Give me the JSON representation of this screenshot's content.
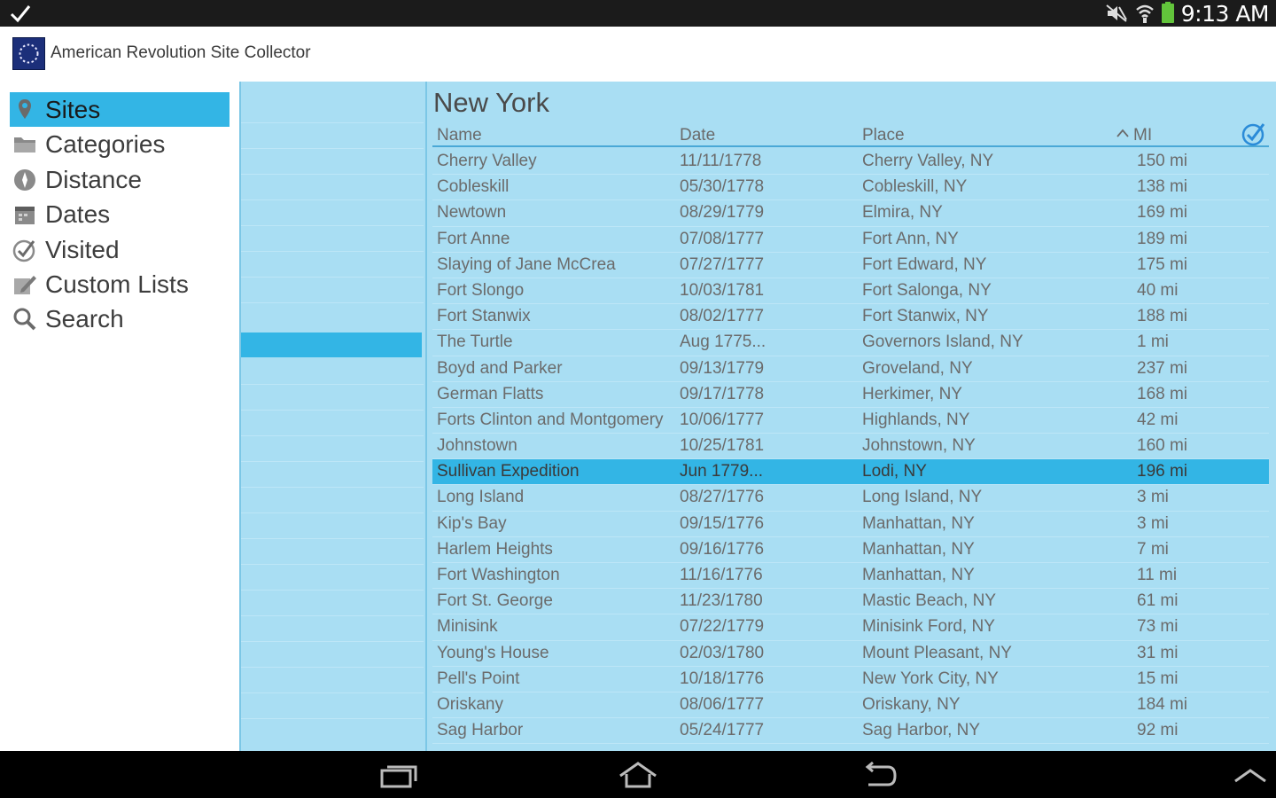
{
  "status": {
    "time": "9:13 AM"
  },
  "app": {
    "title": "American Revolution Site Collector"
  },
  "nav": {
    "items": [
      {
        "label": "Sites",
        "icon": "pin-icon",
        "active": true
      },
      {
        "label": "Categories",
        "icon": "folder-icon",
        "active": false
      },
      {
        "label": "Distance",
        "icon": "compass-icon",
        "active": false
      },
      {
        "label": "Dates",
        "icon": "calendar-icon",
        "active": false
      },
      {
        "label": "Visited",
        "icon": "check-circle-icon",
        "active": false
      },
      {
        "label": "Custom Lists",
        "icon": "edit-list-icon",
        "active": false
      },
      {
        "label": "Search",
        "icon": "search-icon",
        "active": false
      }
    ]
  },
  "list": {
    "region": "New York",
    "headers": {
      "name": "Name",
      "date": "Date",
      "place": "Place",
      "mi": "MI"
    },
    "rows": [
      {
        "name": "Cherry Valley",
        "date": "11/11/1778",
        "place": "Cherry Valley, NY",
        "mi": "150 mi"
      },
      {
        "name": "Cobleskill",
        "date": "05/30/1778",
        "place": "Cobleskill, NY",
        "mi": "138 mi"
      },
      {
        "name": "Newtown",
        "date": "08/29/1779",
        "place": "Elmira, NY",
        "mi": "169 mi"
      },
      {
        "name": "Fort Anne",
        "date": "07/08/1777",
        "place": "Fort Ann, NY",
        "mi": "189 mi"
      },
      {
        "name": "Slaying of Jane McCrea",
        "date": "07/27/1777",
        "place": "Fort Edward, NY",
        "mi": "175 mi"
      },
      {
        "name": "Fort Slongo",
        "date": "10/03/1781",
        "place": "Fort Salonga, NY",
        "mi": "40 mi"
      },
      {
        "name": "Fort Stanwix",
        "date": "08/02/1777",
        "place": "Fort Stanwix, NY",
        "mi": "188 mi"
      },
      {
        "name": "The Turtle",
        "date": "Aug 1775...",
        "place": "Governors Island, NY",
        "mi": "1 mi"
      },
      {
        "name": "Boyd and Parker",
        "date": "09/13/1779",
        "place": "Groveland, NY",
        "mi": "237 mi"
      },
      {
        "name": "German Flatts",
        "date": "09/17/1778",
        "place": "Herkimer, NY",
        "mi": "168 mi"
      },
      {
        "name": "Forts Clinton and Montgomery",
        "date": "10/06/1777",
        "place": "Highlands, NY",
        "mi": "42 mi"
      },
      {
        "name": "Johnstown",
        "date": "10/25/1781",
        "place": "Johnstown, NY",
        "mi": "160 mi"
      },
      {
        "name": "Sullivan Expedition",
        "date": "Jun 1779...",
        "place": "Lodi, NY",
        "mi": "196 mi",
        "selected": true
      },
      {
        "name": "Long Island",
        "date": "08/27/1776",
        "place": "Long Island, NY",
        "mi": "3 mi"
      },
      {
        "name": "Kip's Bay",
        "date": "09/15/1776",
        "place": "Manhattan, NY",
        "mi": "3 mi"
      },
      {
        "name": "Harlem Heights",
        "date": "09/16/1776",
        "place": "Manhattan, NY",
        "mi": "7 mi"
      },
      {
        "name": "Fort Washington",
        "date": "11/16/1776",
        "place": "Manhattan, NY",
        "mi": "11 mi"
      },
      {
        "name": "Fort St. George",
        "date": "11/23/1780",
        "place": "Mastic Beach, NY",
        "mi": "61 mi"
      },
      {
        "name": "Minisink",
        "date": "07/22/1779",
        "place": "Minisink Ford, NY",
        "mi": "73 mi"
      },
      {
        "name": "Young's House",
        "date": "02/03/1780",
        "place": "Mount Pleasant, NY",
        "mi": "31 mi"
      },
      {
        "name": "Pell's Point",
        "date": "10/18/1776",
        "place": "New York City, NY",
        "mi": "15 mi"
      },
      {
        "name": "Oriskany",
        "date": "08/06/1777",
        "place": "Oriskany, NY",
        "mi": "184 mi"
      },
      {
        "name": "Sag Harbor",
        "date": "05/24/1777",
        "place": "Sag Harbor, NY",
        "mi": "92 mi"
      }
    ]
  },
  "colors": {
    "accent": "#33b5e5",
    "panel": "#a9def3",
    "statusbar": "#1b1b1b"
  }
}
